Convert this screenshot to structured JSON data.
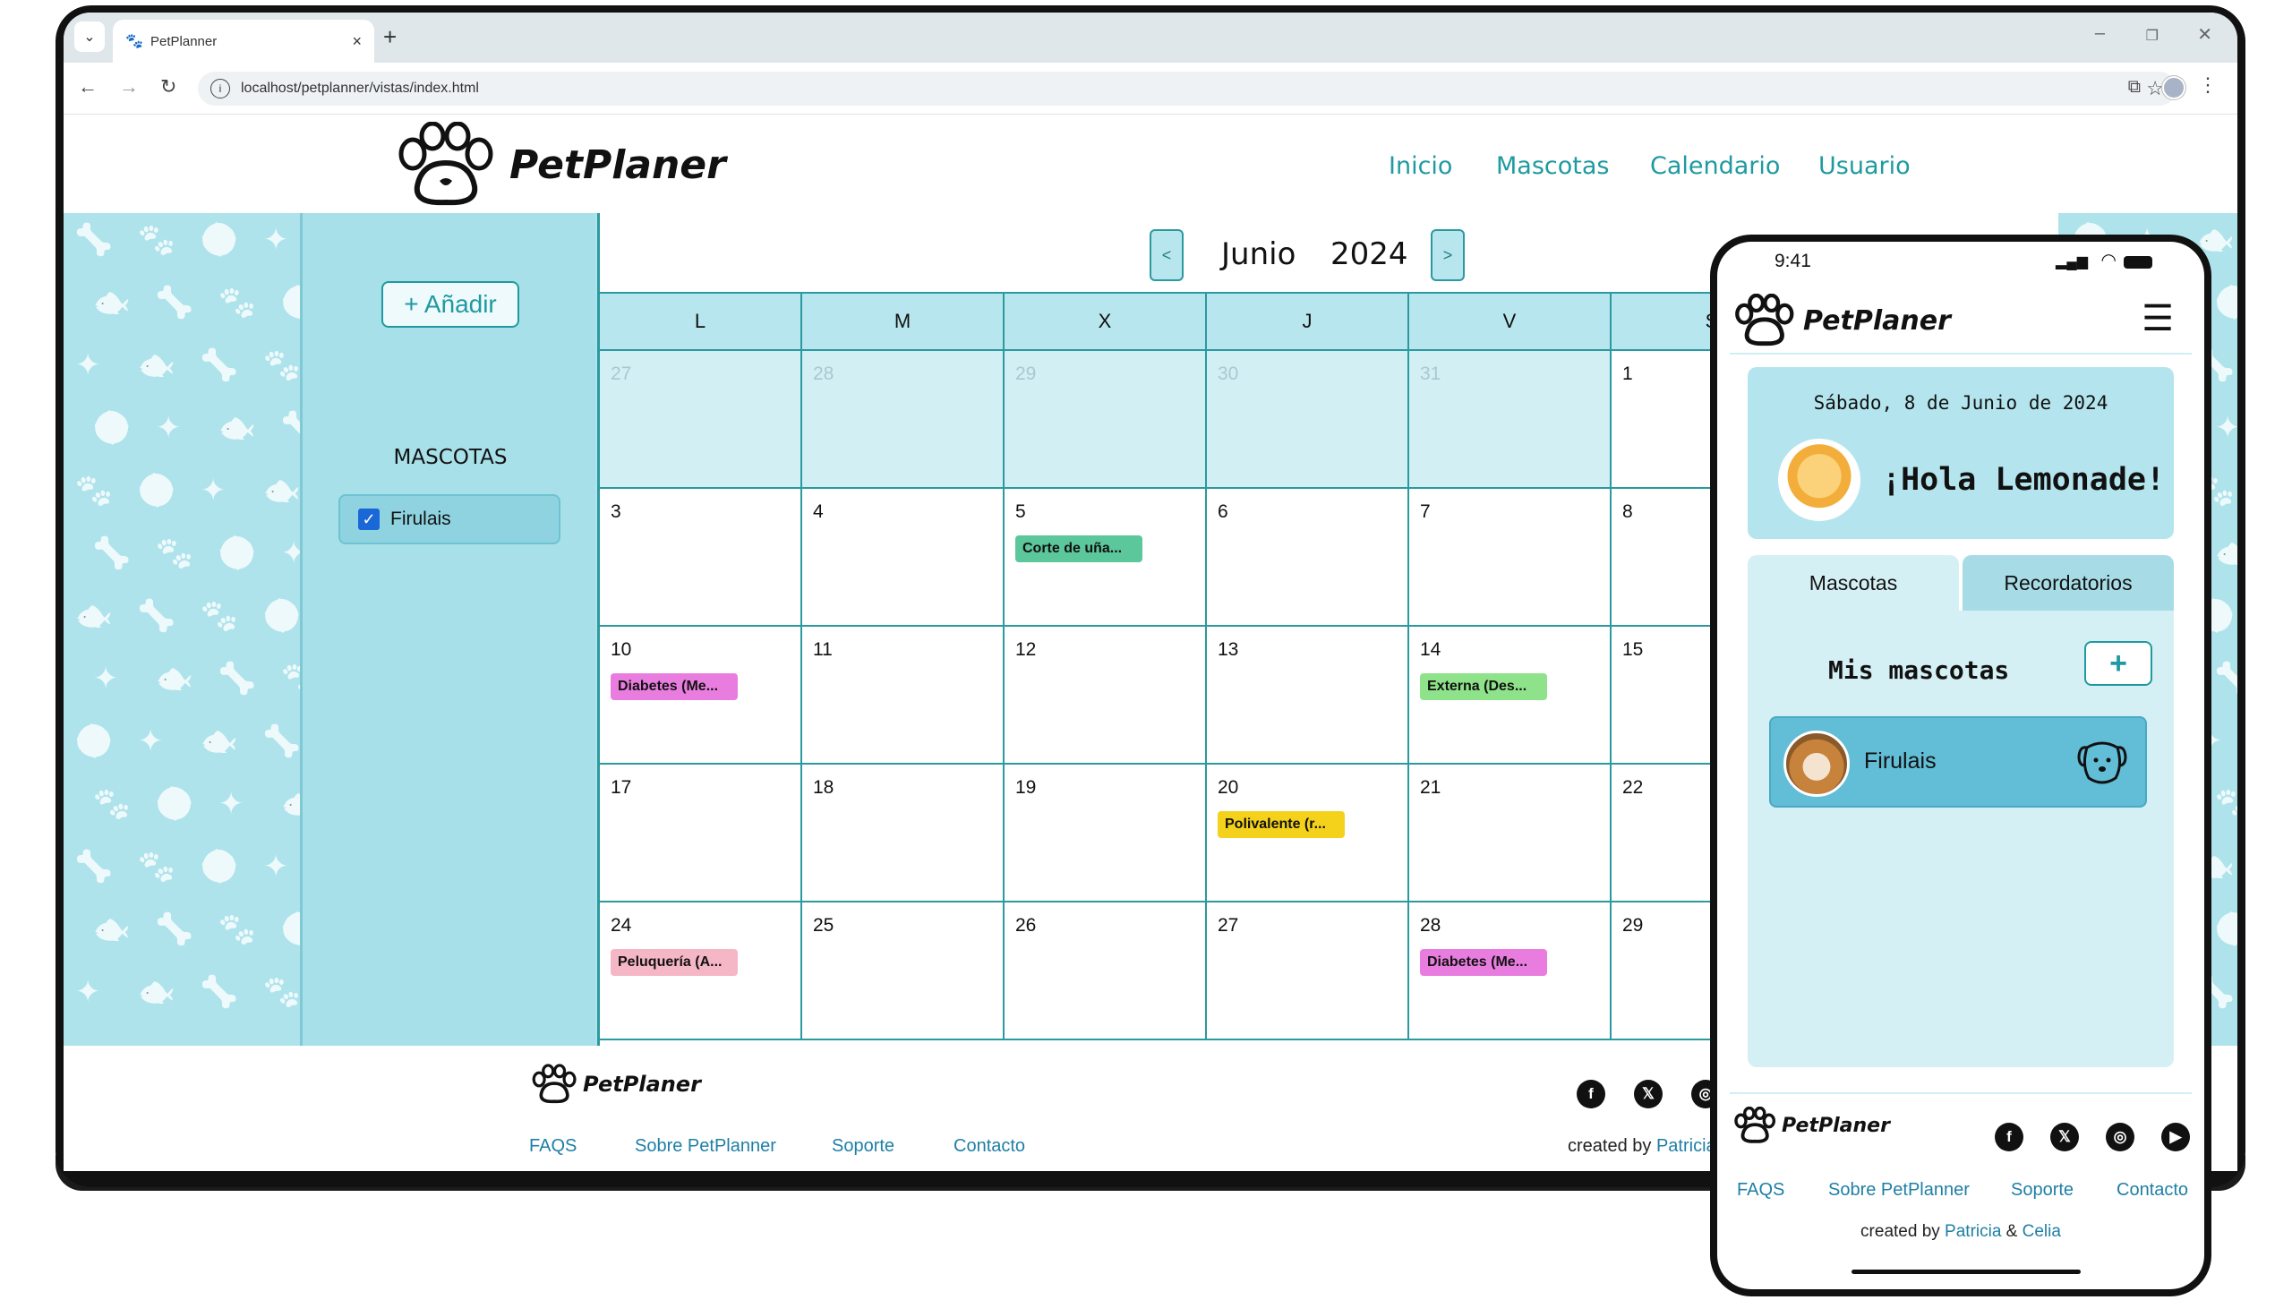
{
  "browser": {
    "tab_title": "PetPlanner",
    "new_tab": "+",
    "url": "localhost/petplanner/vistas/index.html"
  },
  "site": {
    "logo_text": "PetPlaner",
    "nav": [
      "Inicio",
      "Mascotas",
      "Calendario",
      "Usuario"
    ],
    "accent_color": "#1f9aa1"
  },
  "sidebar": {
    "add_label": "+ Añadir",
    "pets_title": "MASCOTAS",
    "pets": [
      {
        "name": "Firulais",
        "checked": true
      }
    ]
  },
  "calendar": {
    "month": "Junio",
    "year": "2024",
    "prev": "<",
    "next": ">",
    "weekdays": [
      "L",
      "M",
      "X",
      "J",
      "V",
      "S"
    ],
    "weeks": [
      [
        {
          "n": "27",
          "other": true
        },
        {
          "n": "28",
          "other": true
        },
        {
          "n": "29",
          "other": true
        },
        {
          "n": "30",
          "other": true
        },
        {
          "n": "31",
          "other": true
        },
        {
          "n": "1"
        }
      ],
      [
        {
          "n": "3"
        },
        {
          "n": "4"
        },
        {
          "n": "5",
          "event": "Corte de uña...",
          "color": "#5cc79b"
        },
        {
          "n": "6"
        },
        {
          "n": "7"
        },
        {
          "n": "8"
        }
      ],
      [
        {
          "n": "10",
          "event": "Diabetes (Me...",
          "color": "#e97ddf"
        },
        {
          "n": "11"
        },
        {
          "n": "12"
        },
        {
          "n": "13"
        },
        {
          "n": "14",
          "event": "Externa (Des...",
          "color": "#8ee28a"
        },
        {
          "n": "15"
        }
      ],
      [
        {
          "n": "17"
        },
        {
          "n": "18"
        },
        {
          "n": "19"
        },
        {
          "n": "20",
          "event": "Polivalente (r...",
          "color": "#f4d21b"
        },
        {
          "n": "21"
        },
        {
          "n": "22"
        }
      ],
      [
        {
          "n": "24",
          "event": "Peluquería (A...",
          "color": "#f5b6c6"
        },
        {
          "n": "25"
        },
        {
          "n": "26"
        },
        {
          "n": "27"
        },
        {
          "n": "28",
          "event": "Diabetes (Me...",
          "color": "#e97ddf"
        },
        {
          "n": "29"
        }
      ]
    ]
  },
  "footer": {
    "logo_text": "PetPlaner",
    "links": [
      "FAQS",
      "Sobre PetPlanner",
      "Soporte",
      "Contacto"
    ],
    "social": [
      "facebook-icon",
      "x-icon",
      "instagram-icon"
    ],
    "created_prefix": "created by ",
    "created_name": "Patricia"
  },
  "phone": {
    "time": "9:41",
    "logo_text": "PetPlaner",
    "date": "Sábado, 8 de Junio de 2024",
    "greeting": "¡Hola Lemonade!",
    "tabs": [
      "Mascotas",
      "Recordatorios"
    ],
    "mis_mascotas": "Mis mascotas",
    "plus": "+",
    "pet_name": "Firulais",
    "footer_logo": "PetPlaner",
    "footer_links": [
      "FAQS",
      "Sobre PetPlanner",
      "Soporte",
      "Contacto"
    ],
    "social": [
      "facebook-icon",
      "x-icon",
      "instagram-icon",
      "youtube-icon"
    ],
    "created_prefix": "created by ",
    "created_name1": "Patricia",
    "created_and": " & ",
    "created_name2": "Celia"
  }
}
